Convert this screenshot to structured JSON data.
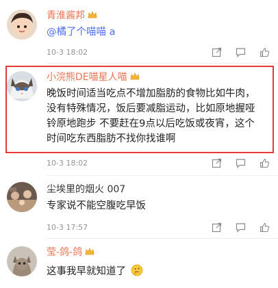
{
  "comments": [
    {
      "username": "青淮酱邦",
      "text": "@橘了个喵喵 a",
      "time": "10-3 18:02",
      "verified": true
    },
    {
      "username": "小浣熊DE喵星人喵",
      "text": "晚饭时间适当吃点不增加脂肪的食物比如牛肉，没有特殊情况，饭后要减脂运动，比如原地握哑铃原地跑步 不要赶在9点以后吃饭或夜宵，这个时间吃东西脂肪不找你找谁啊",
      "time": "10-3 18:02",
      "verified": true
    },
    {
      "username": "尘埃里的烟火 007",
      "text": "专家说不能空腹吃早饭",
      "time": "10-3 17:57",
      "verified": false
    },
    {
      "username": "莹-鸽-鸽",
      "text": "这事我早就知道了",
      "time": "",
      "verified": true
    }
  ],
  "colors": {
    "username": "#eb7350",
    "highlight_border": "#e53935",
    "mention": "#4e6ef2"
  },
  "icons": [
    "share-icon",
    "comment-icon",
    "like-icon",
    "verified-crown-icon",
    "thinking-emoji-icon"
  ]
}
